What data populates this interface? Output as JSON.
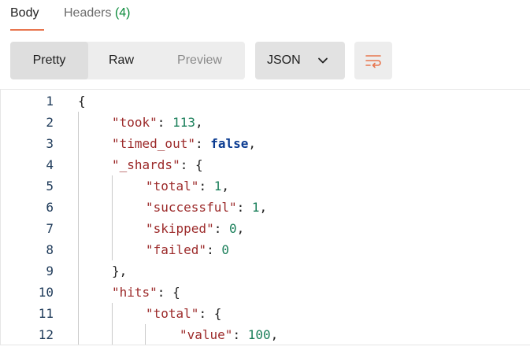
{
  "tabs": {
    "body_label": "Body",
    "headers_label": "Headers",
    "headers_count": "(4)"
  },
  "toolbar": {
    "view_modes": [
      "Pretty",
      "Raw",
      "Preview"
    ],
    "active_view": "Pretty",
    "format": "JSON",
    "format_icon": "chevron-down-icon",
    "wrap_icon": "text-wrap-icon"
  },
  "colors": {
    "accent": "#e8764f",
    "count": "#0a8a3a",
    "key": "#9c2a2a",
    "number": "#1a7f5a",
    "boolean": "#0a3b91",
    "line_number": "#1f3b5a"
  },
  "code": {
    "line_numbers": [
      "1",
      "2",
      "3",
      "4",
      "5",
      "6",
      "7",
      "8",
      "9",
      "10",
      "11",
      "12"
    ],
    "lines": [
      {
        "open": "{"
      },
      {
        "key": "\"took\"",
        "sep": ": ",
        "num": "113",
        "end": ","
      },
      {
        "key": "\"timed_out\"",
        "sep": ": ",
        "bool": "false",
        "end": ","
      },
      {
        "key": "\"_shards\"",
        "sep": ": ",
        "open": "{"
      },
      {
        "key": "\"total\"",
        "sep": ": ",
        "num": "1",
        "end": ","
      },
      {
        "key": "\"successful\"",
        "sep": ": ",
        "num": "1",
        "end": ","
      },
      {
        "key": "\"skipped\"",
        "sep": ": ",
        "num": "0",
        "end": ","
      },
      {
        "key": "\"failed\"",
        "sep": ": ",
        "num": "0"
      },
      {
        "close": "},"
      },
      {
        "key": "\"hits\"",
        "sep": ": ",
        "open": "{"
      },
      {
        "key": "\"total\"",
        "sep": ": ",
        "open": "{"
      },
      {
        "key": "\"value\"",
        "sep": ": ",
        "num": "100",
        "end": ","
      }
    ]
  }
}
